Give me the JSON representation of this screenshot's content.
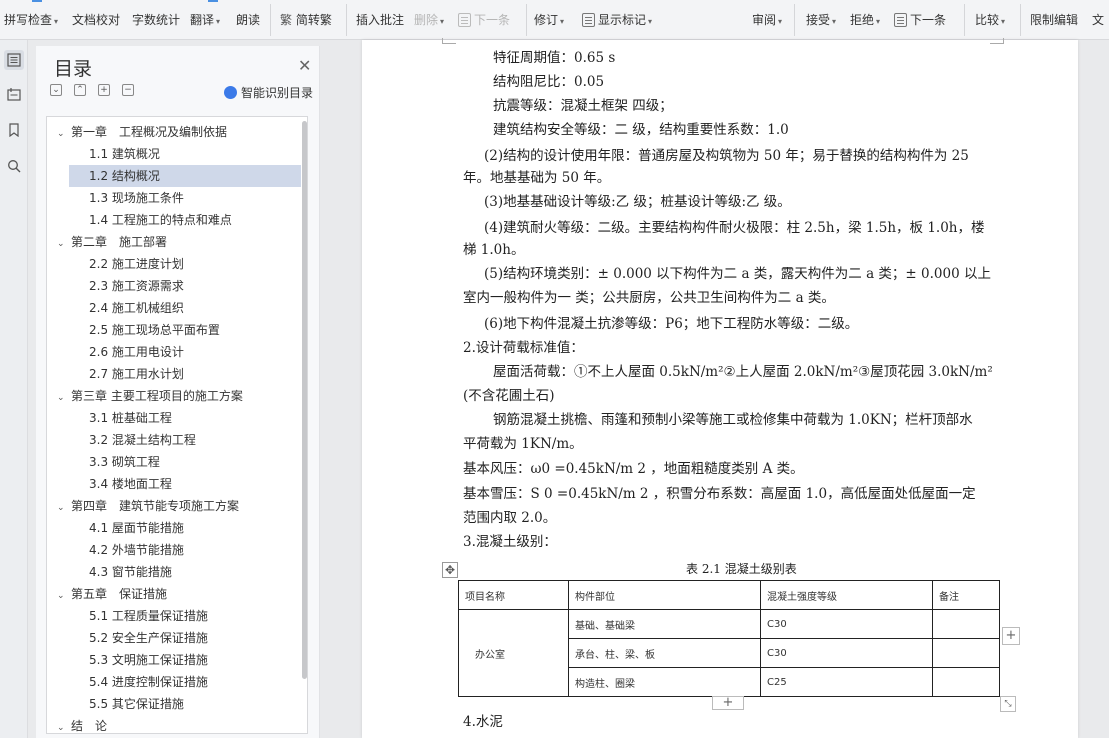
{
  "toolbar": {
    "items": [
      "拼写检查",
      "文档校对",
      "字数统计",
      "翻译",
      "朗读",
      "简转繁",
      "插入批注",
      "删除",
      "下一条",
      "修订",
      "显示标记",
      "审阅",
      "接受",
      "拒绝",
      "下一条",
      "比较",
      "限制编辑",
      "文"
    ]
  },
  "sidebar_icons": [
    "toc-icon",
    "nav-pane-icon",
    "bookmark-icon",
    "search-icon"
  ],
  "toc": {
    "title": "目录",
    "smart_label": "智能识别目录",
    "items": [
      {
        "label": "第一章　工程概况及编制依据",
        "level": "chapter"
      },
      {
        "label": "1.1  建筑概况",
        "level": "section"
      },
      {
        "label": "1.2  结构概况",
        "level": "section",
        "selected": true
      },
      {
        "label": "1.3  现场施工条件",
        "level": "section"
      },
      {
        "label": "1.4  工程施工的特点和难点",
        "level": "section"
      },
      {
        "label": "第二章　施工部署",
        "level": "chapter"
      },
      {
        "label": "2.2  施工进度计划",
        "level": "section"
      },
      {
        "label": "2.3  施工资源需求",
        "level": "section"
      },
      {
        "label": "2.4  施工机械组织",
        "level": "section"
      },
      {
        "label": "2.5  施工现场总平面布置",
        "level": "section"
      },
      {
        "label": "2.6  施工用电设计",
        "level": "section"
      },
      {
        "label": "2.7  施工用水计划",
        "level": "section"
      },
      {
        "label": "第三章 主要工程项目的施工方案",
        "level": "chapter"
      },
      {
        "label": "3.1  桩基础工程",
        "level": "section"
      },
      {
        "label": "3.2  混凝土结构工程",
        "level": "section"
      },
      {
        "label": "3.3  砌筑工程",
        "level": "section"
      },
      {
        "label": "3.4  楼地面工程",
        "level": "section"
      },
      {
        "label": "第四章　建筑节能专项施工方案",
        "level": "chapter"
      },
      {
        "label": "4.1  屋面节能措施",
        "level": "section"
      },
      {
        "label": "4.2  外墙节能措施",
        "level": "section"
      },
      {
        "label": "4.3  窗节能措施",
        "level": "section"
      },
      {
        "label": "第五章　保证措施",
        "level": "chapter"
      },
      {
        "label": "5.1  工程质量保证措施",
        "level": "section"
      },
      {
        "label": "5.2  安全生产保证措施",
        "level": "section"
      },
      {
        "label": "5.3  文明施工保证措施",
        "level": "section"
      },
      {
        "label": "5.4  进度控制保证措施",
        "level": "section"
      },
      {
        "label": "5.5  其它保证措施",
        "level": "section"
      },
      {
        "label": "结　论",
        "level": "chapter"
      }
    ]
  },
  "document": {
    "paragraphs": [
      "特征周期值：0.65 s",
      "结构阻尼比：0.05",
      "抗震等级：混凝土框架 四级；",
      "建筑结构安全等级：二 级，结构重要性系数：1.0",
      "(2)结构的设计使用年限：普通房屋及构筑物为 50 年；易于替换的结构构件为 25",
      "年。地基基础为 50 年。",
      "(3)地基基础设计等级:乙 级；桩基设计等级:乙 级。",
      "(4)建筑耐火等级：二级。主要结构构件耐火极限：柱 2.5h，梁 1.5h，板 1.0h，楼",
      "梯 1.0h。",
      "(5)结构环境类别：± 0.000 以下构件为二 a 类，露天构件为二 a 类；± 0.000 以上",
      "室内一般构件为一 类；公共厨房，公共卫生间构件为二 a 类。",
      "(6)地下构件混凝土抗渗等级：P6；地下工程防水等级：二级。",
      "2.设计荷载标准值：",
      "屋面活荷载：①不上人屋面 0.5kN/m²②上人屋面 2.0kN/m²③屋顶花园 3.0kN/m²",
      "(不含花圃土石)",
      "钢筋混凝土挑檐、雨篷和预制小梁等施工或检修集中荷载为 1.0KN；栏杆顶部水",
      "平荷载为 1KN/m。",
      "基本风压：ω0 =0.45kN/m 2 ，地面粗糙度类别 A 类。",
      "基本雪压：S 0 =0.45kN/m 2 ，积雪分布系数：高屋面 1.0，高低屋面处低屋面一定",
      "范围内取 2.0。",
      "3.混凝土级别：",
      "4.水泥"
    ],
    "table": {
      "caption": "表 2.1  混凝土级别表",
      "headers": [
        "项目名称",
        "构件部位",
        "混凝土强度等级",
        "备注"
      ],
      "group": "办公室",
      "rows": [
        [
          "基础、基础梁",
          "C30",
          ""
        ],
        [
          "承台、柱、梁、板",
          "C30",
          ""
        ],
        [
          "构造柱、圈梁",
          "C25",
          ""
        ]
      ]
    }
  }
}
